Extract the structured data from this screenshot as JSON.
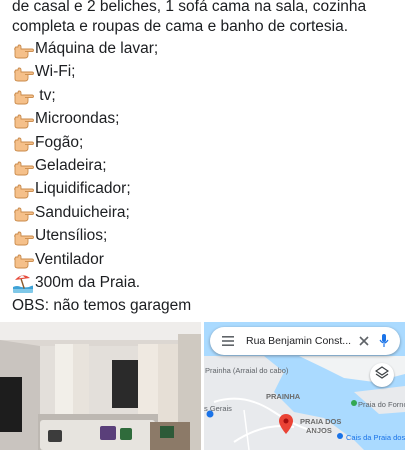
{
  "post": {
    "intro_lines": [
      "de casal e 2 beliches, 1 sofá cama na sala, cozinha",
      "completa e roupas de cama e banho de cortesia."
    ],
    "amenities": [
      {
        "icon": "pointing-hand-icon",
        "label": "Máquina de lavar;"
      },
      {
        "icon": "pointing-hand-icon",
        "label": "Wi-Fi;"
      },
      {
        "icon": "pointing-hand-icon",
        "label": " tv;"
      },
      {
        "icon": "pointing-hand-icon",
        "label": "Microondas;"
      },
      {
        "icon": "pointing-hand-icon",
        "label": "Fogão;"
      },
      {
        "icon": "pointing-hand-icon",
        "label": "Geladeira;"
      },
      {
        "icon": "pointing-hand-icon",
        "label": "Liquidificador;"
      },
      {
        "icon": "pointing-hand-icon",
        "label": "Sanduicheira;"
      },
      {
        "icon": "pointing-hand-icon",
        "label": "Utensílios;"
      },
      {
        "icon": "pointing-hand-icon",
        "label": "Ventilador"
      }
    ],
    "beach": {
      "icon": "beach-umbrella-icon",
      "label": " 300m da Praia."
    },
    "obs": "OBS: não temos garagem"
  },
  "map": {
    "search_text": "Rua Benjamin Const...",
    "labels": {
      "prainha_arraial": "Prainha (Arraial do cabo)",
      "prainha": "PRAINHA",
      "gerais": "s Gerais",
      "praia_dos_anjos_1": "PRAIA DOS",
      "praia_dos_anjos_2": "ANJOS",
      "praia_do_forno": "Praia do Forno",
      "cais": "Cais da Praia dos Anjo"
    }
  }
}
